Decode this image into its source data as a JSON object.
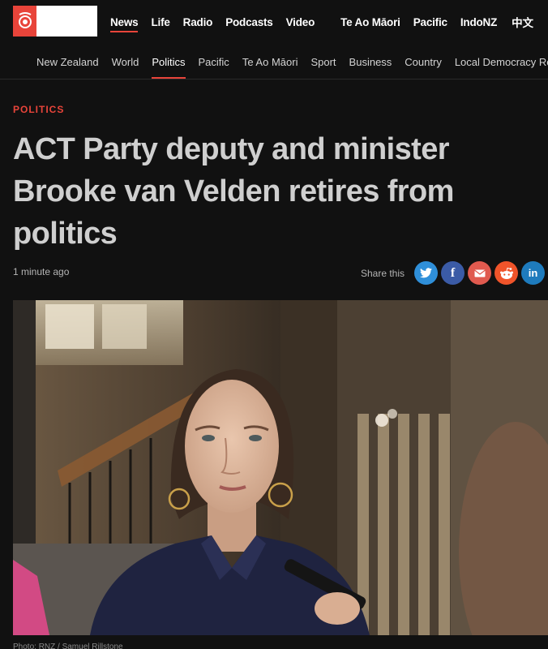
{
  "header": {
    "primary_nav": [
      "News",
      "Life",
      "Radio",
      "Podcasts",
      "Video",
      "Te Ao Māori",
      "Pacific",
      "IndoNZ",
      "中文"
    ],
    "active_primary": "News"
  },
  "subnav": {
    "items": [
      "New Zealand",
      "World",
      "Politics",
      "Pacific",
      "Te Ao Māori",
      "Sport",
      "Business",
      "Country",
      "Local Democracy Re"
    ],
    "active": "Politics"
  },
  "article": {
    "category": "POLITICS",
    "headline": "ACT Party deputy and minister Brooke van Velden retires from politics",
    "timestamp": "1 minute ago",
    "share_label": "Share this",
    "share_icons": [
      "twitter-icon",
      "facebook-icon",
      "email-icon",
      "reddit-icon",
      "linkedin-icon"
    ],
    "photo_caption": "Photo: RNZ / Samuel Rillstone"
  },
  "colors": {
    "accent": "#e8443a",
    "background": "#111111",
    "headline": "#cfcfcf"
  }
}
